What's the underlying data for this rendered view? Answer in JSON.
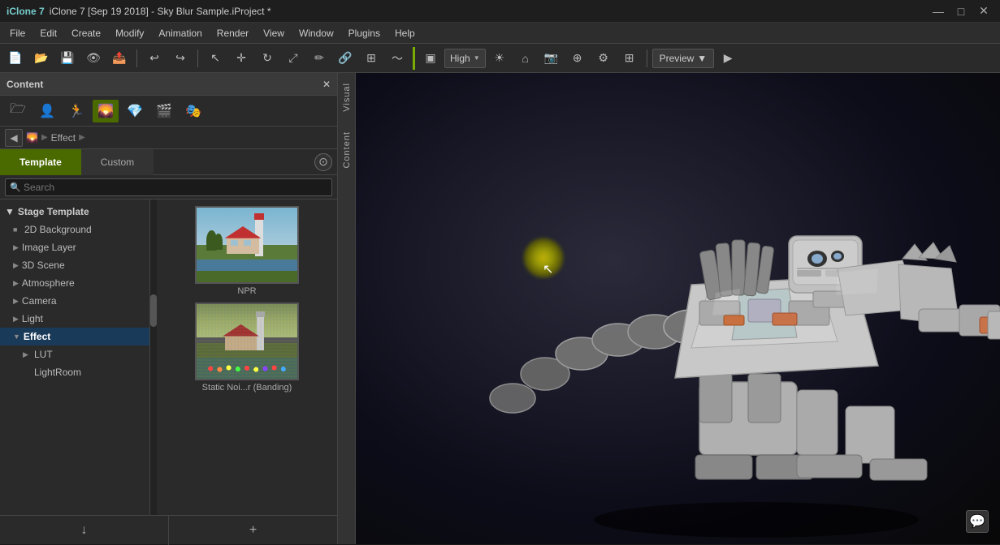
{
  "titlebar": {
    "title": "iClone 7 [Sep 19 2018] - Sky Blur Sample.iProject *",
    "logo": "iClone 7",
    "min": "—",
    "max": "□",
    "close": "✕"
  },
  "menubar": {
    "items": [
      "File",
      "Edit",
      "Create",
      "Modify",
      "Animation",
      "Render",
      "View",
      "Window",
      "Plugins",
      "Help"
    ]
  },
  "toolbar": {
    "quality_label": "High",
    "preview_label": "Preview"
  },
  "content_panel": {
    "title": "Content",
    "close_label": "✕",
    "icons": [
      "🗁",
      "👤",
      "🏃",
      "🌄",
      "💎",
      "🎬",
      "🎭"
    ],
    "breadcrumb": {
      "back": "◀",
      "path": [
        "Effect"
      ],
      "arrow": "▶"
    },
    "tabs": {
      "template": "Template",
      "custom": "Custom"
    },
    "search_placeholder": "Search",
    "tree": {
      "stage_template": "Stage Template",
      "bg_2d": "2D Background",
      "image_layer": "Image Layer",
      "scene_3d": "3D Scene",
      "atmosphere": "Atmosphere",
      "camera": "Camera",
      "light": "Light",
      "effect": "Effect",
      "lut": "LUT",
      "lightroom": "LightRoom"
    },
    "thumbnails": [
      {
        "label": "NPR"
      },
      {
        "label": "Static Noi...r (Banding)"
      }
    ],
    "bottom": {
      "download": "↓",
      "add": "+"
    }
  },
  "vertical_tabs": {
    "visual": "Visual",
    "content": "Content"
  },
  "viewport": {
    "cursor_symbol": "↖"
  }
}
